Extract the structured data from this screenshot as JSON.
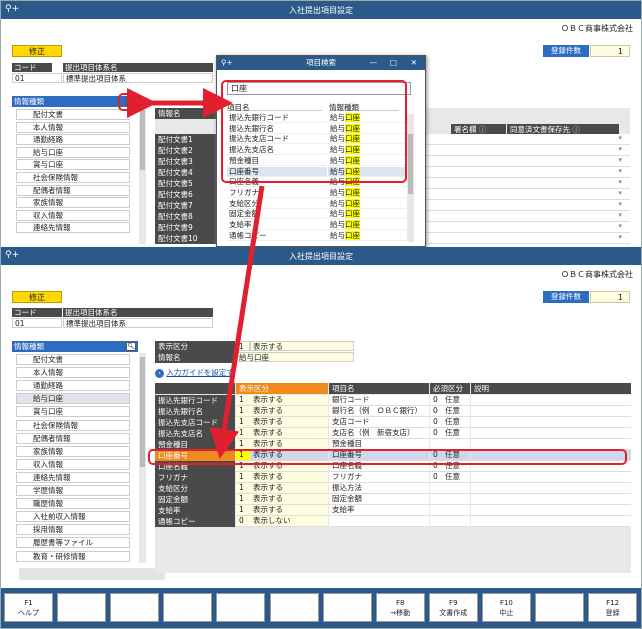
{
  "top_window": {
    "title": "入社提出項目設定",
    "company": "ＯＢＣ商事株式会社",
    "edit_label": "修正",
    "count_label": "登録件数",
    "count_value": "1",
    "code_header": "コード",
    "name_header": "提出項目体系名",
    "code_value": "01",
    "name_value": "標準提出項目体系",
    "sidebar_header": "情報種類",
    "sidebar_items": [
      "配付文書",
      "本人情報",
      "通勤経路",
      "給与口座",
      "賞与口座",
      "社会保険情報",
      "配偶者情報",
      "家族情報",
      "収入情報",
      "連絡先情報"
    ],
    "grid_header_left": "情報名",
    "grid_rows": [
      "配付文書1",
      "配付文書2",
      "配付文書3",
      "配付文書4",
      "配付文書5",
      "配付文書6",
      "配付文書7",
      "配付文書8",
      "配付文書9",
      "配付文書10"
    ],
    "col_signature": "署名欄",
    "col_consent": "同意済文書保存先"
  },
  "dialog": {
    "title": "項目検索",
    "search_value": "口座",
    "col_item": "項目名",
    "col_type": "情報種類",
    "rows": [
      {
        "item": "振込先銀行コード",
        "type": "給与口座"
      },
      {
        "item": "振込先銀行名",
        "type": "給与口座"
      },
      {
        "item": "振込先支店コード",
        "type": "給与口座"
      },
      {
        "item": "振込先支店名",
        "type": "給与口座"
      },
      {
        "item": "預金種目",
        "type": "給与口座"
      },
      {
        "item": "口座番号",
        "type": "給与口座"
      },
      {
        "item": "口座名義",
        "type": "給与口座"
      },
      {
        "item": "フリガナ",
        "type": "給与口座"
      },
      {
        "item": "支給区分",
        "type": "給与口座"
      },
      {
        "item": "固定金額",
        "type": "給与口座"
      },
      {
        "item": "支給率",
        "type": "給与口座"
      },
      {
        "item": "通帳コピー",
        "type": "給与口座"
      }
    ]
  },
  "bottom_window": {
    "title": "入社提出項目設定",
    "company": "ＯＢＣ商事株式会社",
    "edit_label": "修正",
    "count_label": "登録件数",
    "count_value": "1",
    "code_header": "コード",
    "name_header": "提出項目体系名",
    "code_value": "01",
    "name_value": "標準提出項目体系",
    "sidebar_header": "情報種類",
    "sidebar_items": [
      "配付文書",
      "本人情報",
      "通勤経路",
      "給与口座",
      "賞与口座",
      "社会保険情報",
      "配偶者情報",
      "家族情報",
      "収入情報",
      "連絡先情報",
      "学歴情報",
      "職歴情報",
      "入社前収入情報",
      "採用情報",
      "履歴書等ファイル",
      "教育・研修情報"
    ],
    "display_label": "表示区分",
    "display_num": "1",
    "display_value": "表示する",
    "info_label": "情報名",
    "info_value": "給与口座",
    "guide_link": "入力ガイドを設定す",
    "col_display": "表示区分",
    "col_item": "項目名",
    "col_required": "必須区分",
    "col_desc": "説明",
    "rows": [
      {
        "label": "振込先銀行コード",
        "num": "1",
        "disp": "表示する",
        "item": "銀行コード",
        "rnum": "0",
        "req": "任意"
      },
      {
        "label": "振込先銀行名",
        "num": "1",
        "disp": "表示する",
        "item": "銀行名（例　ＯＢＣ銀行）",
        "rnum": "0",
        "req": "任意"
      },
      {
        "label": "振込先支店コード",
        "num": "1",
        "disp": "表示する",
        "item": "支店コード",
        "rnum": "0",
        "req": "任意"
      },
      {
        "label": "振込先支店名",
        "num": "1",
        "disp": "表示する",
        "item": "支店名（例　新宿支店）",
        "rnum": "0",
        "req": "任意"
      },
      {
        "label": "預金種目",
        "num": "1",
        "disp": "表示する",
        "item": "預金種目",
        "rnum": "",
        "req": ""
      },
      {
        "label": "口座番号",
        "num": "1",
        "disp": "表示する",
        "item": "口座番号",
        "rnum": "0",
        "req": "任意"
      },
      {
        "label": "口座名義",
        "num": "1",
        "disp": "表示する",
        "item": "口座名義",
        "rnum": "0",
        "req": "任意"
      },
      {
        "label": "フリガナ",
        "num": "1",
        "disp": "表示する",
        "item": "フリガナ",
        "rnum": "0",
        "req": "任意"
      },
      {
        "label": "支給区分",
        "num": "1",
        "disp": "表示する",
        "item": "振込方法",
        "rnum": "",
        "req": ""
      },
      {
        "label": "固定金額",
        "num": "1",
        "disp": "表示する",
        "item": "固定金額",
        "rnum": "",
        "req": ""
      },
      {
        "label": "支給率",
        "num": "1",
        "disp": "表示する",
        "item": "支給率",
        "rnum": "",
        "req": ""
      },
      {
        "label": "通帳コピー",
        "num": "0",
        "disp": "表示しない",
        "item": "",
        "rnum": "",
        "req": ""
      }
    ]
  },
  "fkeys": [
    {
      "key": "F1",
      "label": "ヘルプ"
    },
    {
      "key": "",
      "label": ""
    },
    {
      "key": "",
      "label": ""
    },
    {
      "key": "",
      "label": ""
    },
    {
      "key": "",
      "label": ""
    },
    {
      "key": "",
      "label": ""
    },
    {
      "key": "",
      "label": ""
    },
    {
      "key": "F8",
      "label": "→移動"
    },
    {
      "key": "F9",
      "label": "文書作成"
    },
    {
      "key": "F10",
      "label": "中止"
    },
    {
      "key": "",
      "label": ""
    },
    {
      "key": "F12",
      "label": "登録"
    }
  ]
}
